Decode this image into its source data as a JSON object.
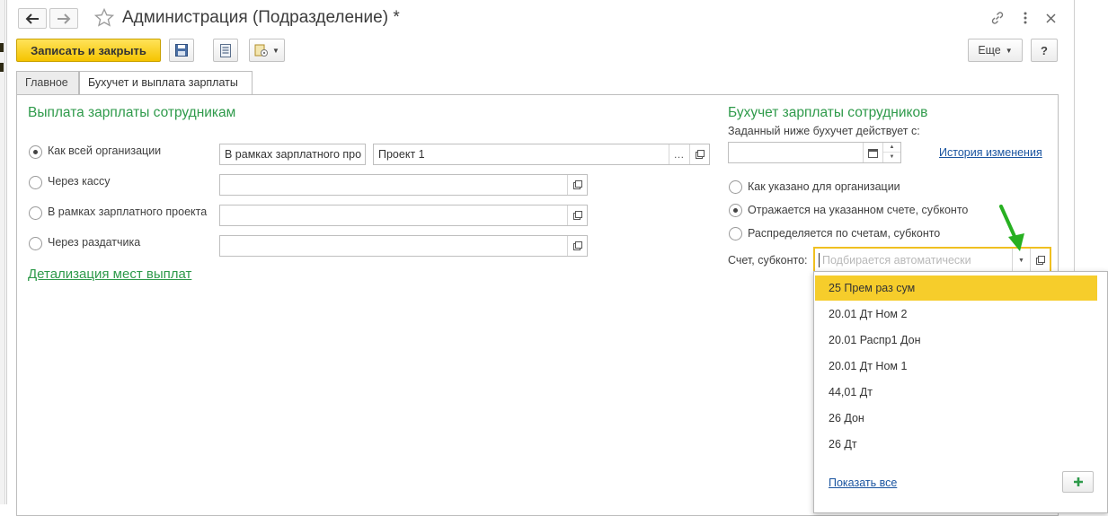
{
  "window": {
    "title": "Администрация (Подразделение) *"
  },
  "toolbar": {
    "save_close_label": "Записать и закрыть",
    "more_label": "Еще",
    "help_label": "?"
  },
  "tabs": [
    {
      "label": "Главное",
      "active": false
    },
    {
      "label": "Бухучет и выплата зарплаты",
      "active": true
    }
  ],
  "payment": {
    "heading": "Выплата зарплаты сотрудникам",
    "options": [
      {
        "label": "Как всей организации",
        "selected": true
      },
      {
        "label": "Через кассу",
        "selected": false
      },
      {
        "label": "В рамках зарплатного проекта",
        "selected": false
      },
      {
        "label": "Через раздатчика",
        "selected": false
      }
    ],
    "org_field_value": "В рамках зарплатного про",
    "project_field_value": "Проект 1",
    "details_link": "Детализация мест выплат"
  },
  "accounting": {
    "heading": "Бухучет зарплаты сотрудников",
    "date_label": "Заданный ниже бухучет действует с:",
    "date_value": "",
    "history_link": "История изменения",
    "options": [
      {
        "label": "Как указано для организации",
        "selected": false
      },
      {
        "label": "Отражается на указанном счете, субконто",
        "selected": true
      },
      {
        "label": "Распределяется по счетам, субконто",
        "selected": false
      }
    ],
    "account_label": "Счет, субконто:",
    "account_placeholder": "Подбирается автоматически"
  },
  "dropdown": {
    "items": [
      "25 Прем раз сум",
      "20.01 Дт Ном 2",
      "20.01 Распр1 Дон",
      "20.01 Дт Ном 1",
      "44,01 Дт",
      "26 Дон",
      "26 Дт"
    ],
    "selected_index": 0,
    "show_all_label": "Показать все"
  },
  "colors": {
    "accent_green": "#2e9a4a",
    "primary_yellow": "#f5c400",
    "highlight_yellow": "#f6cd2b",
    "link_blue": "#1b55a0",
    "focus_border": "#f0c020",
    "arrow_green": "#27b021"
  },
  "icons": {
    "back": "arrow-left-icon",
    "forward": "arrow-right-icon",
    "favorite": "star-icon",
    "link": "chain-link-icon",
    "menu": "vertical-dots-icon",
    "close": "close-icon",
    "save": "floppy-disk-icon",
    "report": "document-list-icon",
    "create_based_on": "document-gear-icon",
    "open": "open-window-icon",
    "calendar": "calendar-icon",
    "add": "plus-icon"
  }
}
